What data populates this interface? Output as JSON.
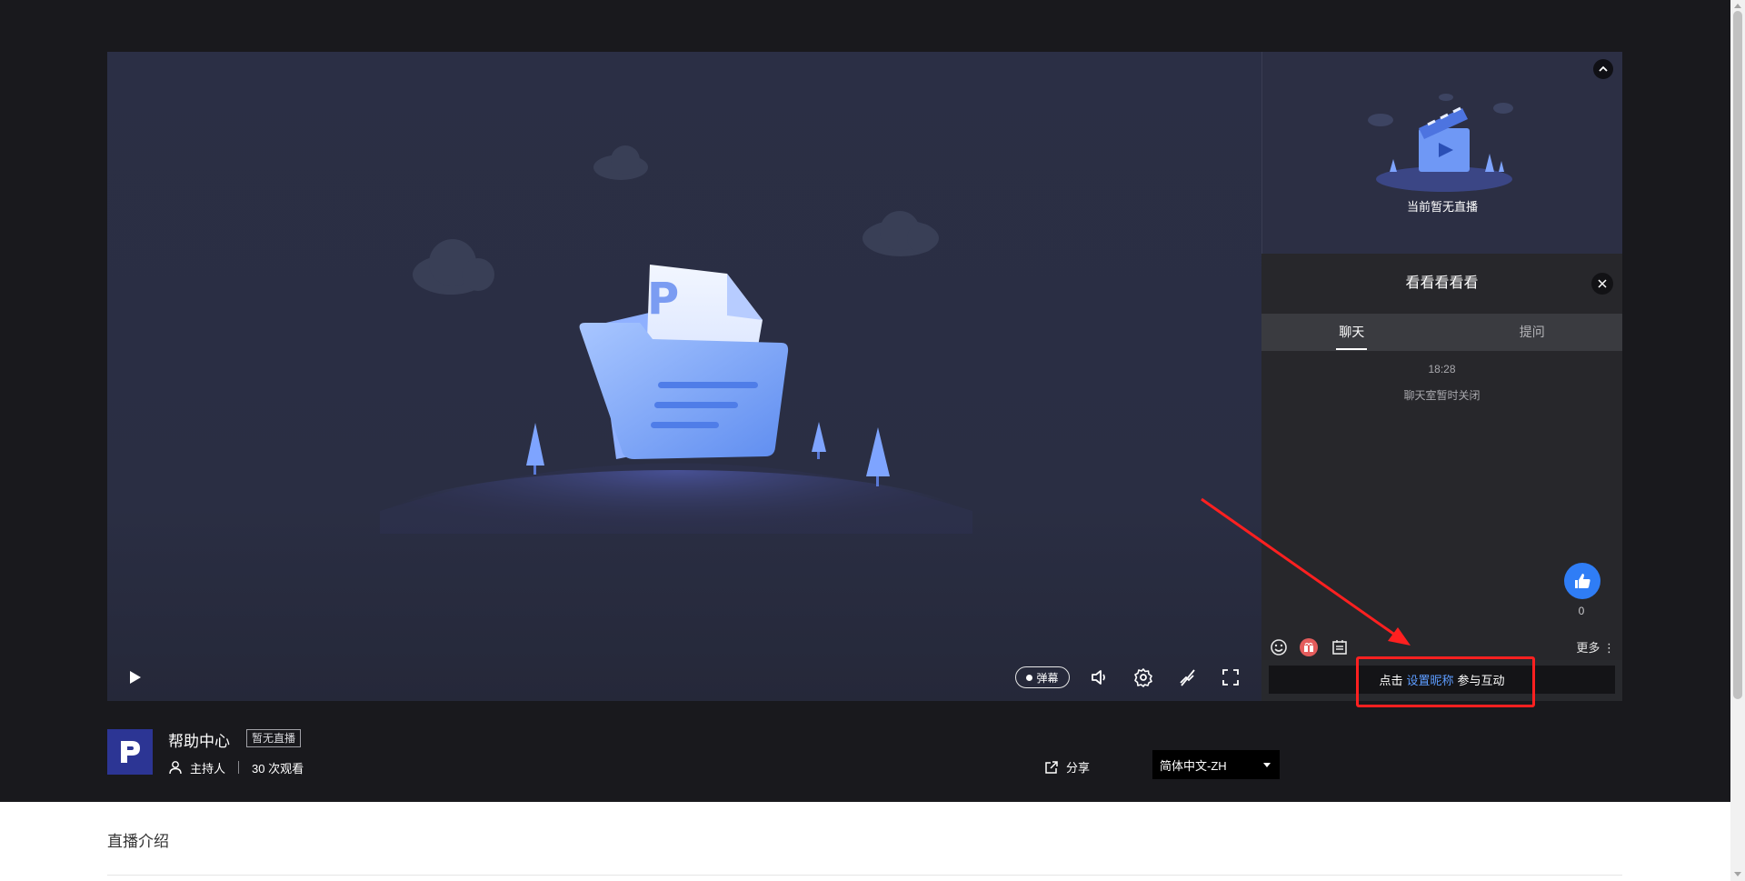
{
  "player": {
    "danmu_label": "弹幕",
    "icons": [
      "play-icon",
      "volume-icon",
      "settings-icon",
      "disable-icon",
      "fullscreen-icon"
    ]
  },
  "side": {
    "mini_message": "当前暂无直播",
    "room_title": "看看看看看",
    "tabs": [
      {
        "label": "聊天",
        "active": true
      },
      {
        "label": "提问",
        "active": false
      }
    ],
    "chat": {
      "time": "18:28",
      "notice": "聊天室暂时关闭",
      "like_count": "0"
    },
    "toolbar": {
      "more_label": "更多",
      "icons": [
        "emoji-icon",
        "gift-icon",
        "notice-icon"
      ]
    },
    "input": {
      "prefix": "点击",
      "link": "设置昵称",
      "suffix": "参与互动"
    }
  },
  "info": {
    "title": "帮助中心",
    "status_badge": "暂无直播",
    "host_label": "主持人",
    "views": "30 次观看",
    "share_label": "分享",
    "language": "简体中文-ZH"
  },
  "intro": {
    "title": "直播介绍"
  },
  "colors": {
    "page_dark": "#19191d",
    "accent_blue": "#2f7df6",
    "link_blue": "#5d9cff",
    "highlight_red": "#ff2020",
    "logo_bg": "#2c3594"
  }
}
